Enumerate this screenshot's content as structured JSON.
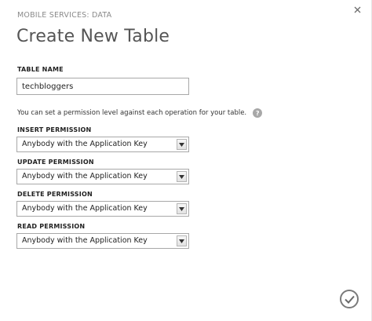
{
  "header": {
    "subtitle": "MOBILE SERVICES: DATA",
    "title": "Create New Table"
  },
  "table_name": {
    "label": "TABLE NAME",
    "value": "techbloggers"
  },
  "permission_hint": "You can set a permission level against each operation for your table.",
  "permissions": [
    {
      "label": "INSERT PERMISSION",
      "value": "Anybody with the Application Key"
    },
    {
      "label": "UPDATE PERMISSION",
      "value": "Anybody with the Application Key"
    },
    {
      "label": "DELETE PERMISSION",
      "value": "Anybody with the Application Key"
    },
    {
      "label": "READ PERMISSION",
      "value": "Anybody with the Application Key"
    }
  ],
  "icons": {
    "close": "close-icon",
    "help": "help-icon",
    "dropdown": "chevron-down-icon",
    "confirm": "checkmark-icon"
  }
}
